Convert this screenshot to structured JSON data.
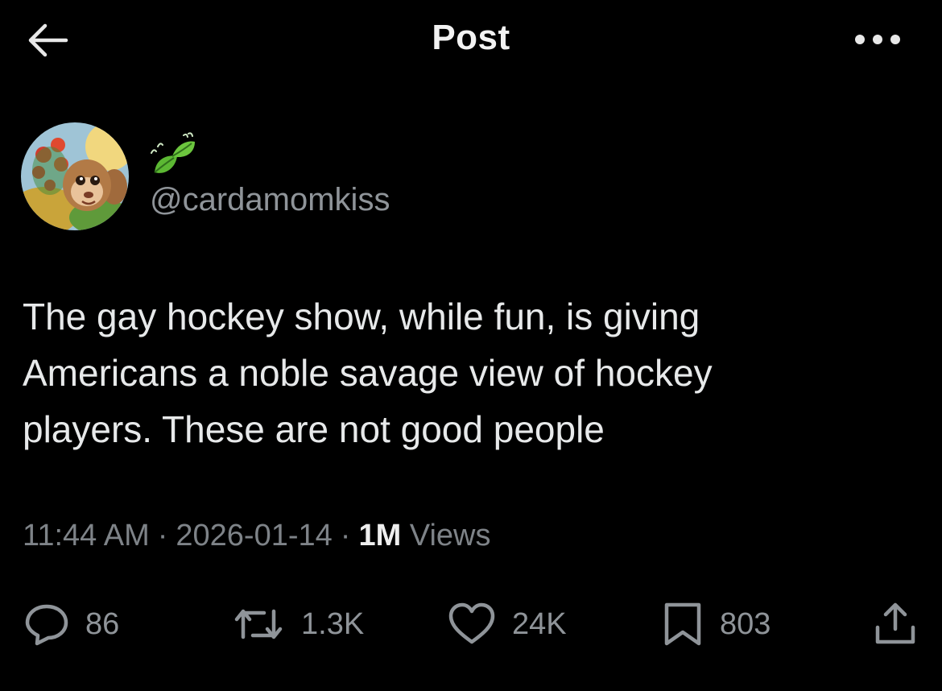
{
  "header": {
    "title": "Post",
    "back_icon": "arrow-left-icon",
    "more_icon": "more-horizontal-icon"
  },
  "author": {
    "display_name_icon": "leaf-emoji-icon",
    "handle": "@cardamomkiss",
    "avatar": "avatar-image"
  },
  "post": {
    "text": "The gay hockey show, while fun, is giving\nAmericans a noble savage view of hockey\nplayers. These are not good people"
  },
  "meta": {
    "time": "11:44 AM",
    "separator": "·",
    "date": "2026-01-14",
    "views_count": "1M",
    "views_label": "Views"
  },
  "actions": {
    "replies": {
      "icon": "reply-icon",
      "count": "86"
    },
    "reposts": {
      "icon": "repost-icon",
      "count": "1.3K"
    },
    "likes": {
      "icon": "heart-icon",
      "count": "24K"
    },
    "bookmarks": {
      "icon": "bookmark-icon",
      "count": "803"
    },
    "share": {
      "icon": "share-icon"
    }
  },
  "colors": {
    "background": "#000000",
    "text_primary": "#e7e9ea",
    "text_secondary": "#8f9499",
    "leaf_green": "#5cb833"
  }
}
